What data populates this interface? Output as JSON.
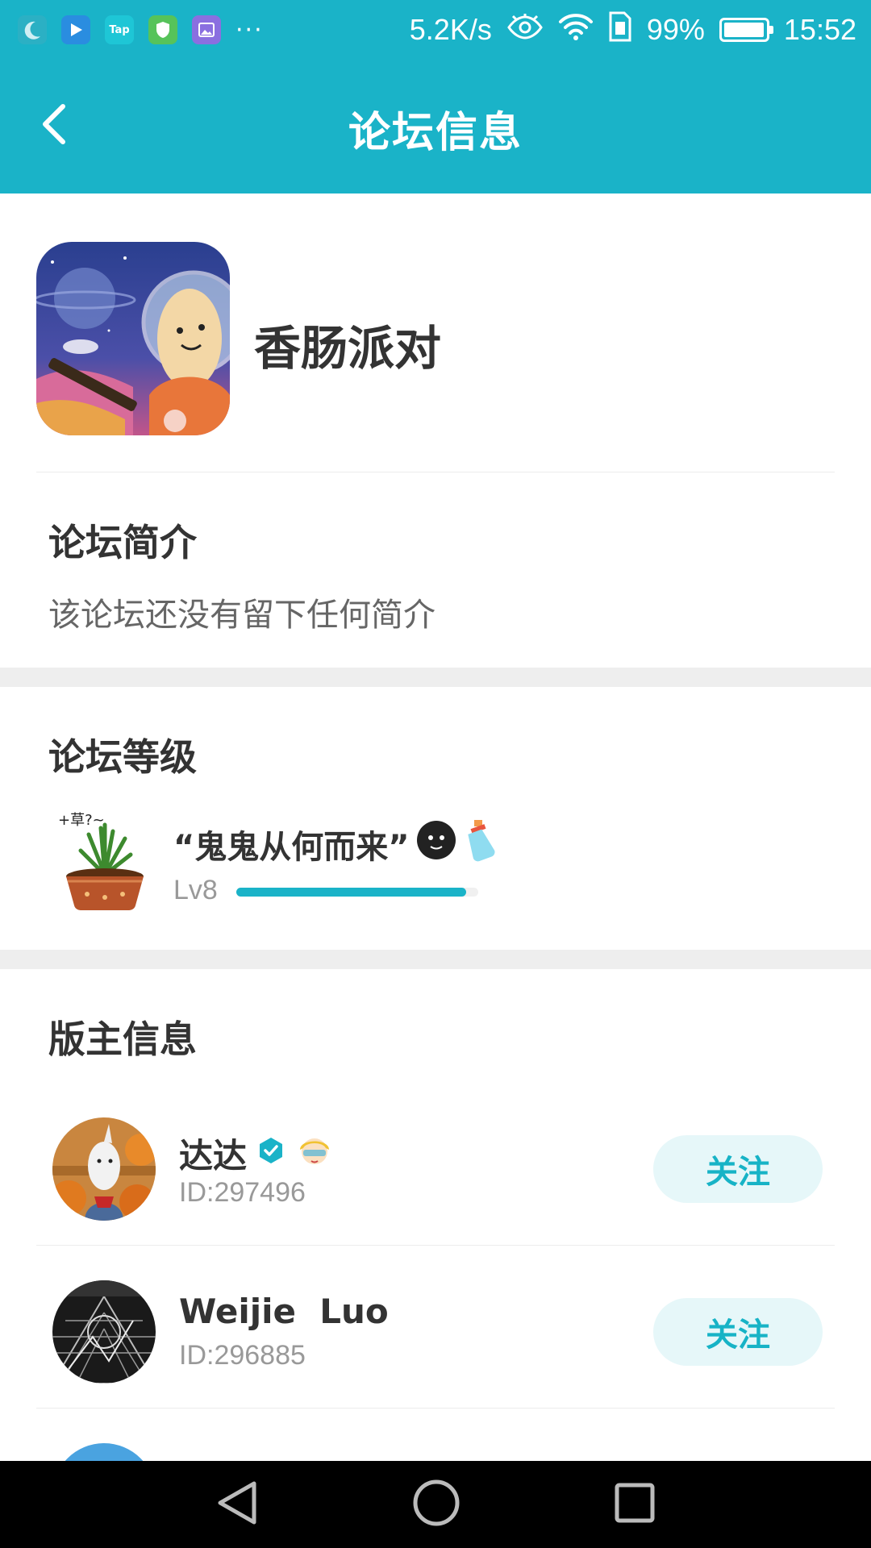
{
  "status_bar": {
    "speed": "5.2K/s",
    "battery": "99%",
    "time": "15:52",
    "tap_label": "Tap"
  },
  "header": {
    "title": "论坛信息"
  },
  "forum": {
    "name": "香肠派对"
  },
  "intro": {
    "title": "论坛简介",
    "text": "该论坛还没有留下任何简介"
  },
  "level": {
    "title": "论坛等级",
    "name": "“鬼鬼从何而来”",
    "lv": "Lv8",
    "progress": 0.95
  },
  "moderators": {
    "title": "版主信息",
    "list": [
      {
        "name": "达达",
        "id": "ID:297496",
        "follow": "关注"
      },
      {
        "name": "Weijie  Luo",
        "id": "ID:296885",
        "follow": "关注"
      }
    ]
  },
  "colors": {
    "accent": "#1ab3c8",
    "follow_bg": "#e6f7f9"
  }
}
